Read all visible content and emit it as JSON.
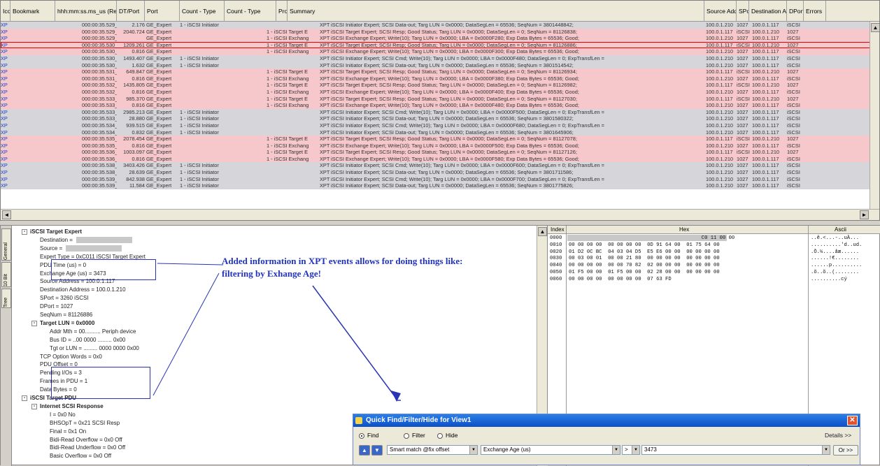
{
  "columns": [
    "Ico",
    "Bookmark",
    "hhh:mm:ss.ms_us (Rel)",
    "DT/Port",
    "Port",
    "Count - Type",
    "Count - Type",
    "Protoc",
    "Summary",
    "Source Addre",
    "SPort",
    "Destination Ad",
    "DPort",
    "Errors"
  ],
  "rows": [
    {
      "ico": "XP",
      "time": "000:00:35.529_477",
      "dt": "2.176",
      "port": "GE_Expert",
      "c1": "1 - iSCSI Initiator",
      "c2": "",
      "proto": "XPT",
      "summary": "iSCSI Initiator Expert; SCSI Data-out; Targ LUN = 0x0000; DataSegLen = 65536; SeqNum = 3801448842;",
      "src": "100.0.1.210",
      "sport": "1027",
      "dst": "100.0.1.117",
      "dport": "iSCSI",
      "c": "gray"
    },
    {
      "ico": "XP",
      "time": "000:00:35.529_549",
      "dt": "2040.724",
      "port": "GE_Expert",
      "c1": "",
      "c2": "1 - iSCSI Target E",
      "proto": "XPT",
      "summary": "iSCSI Target Expert; SCSI Resp; Good Status; Targ LUN = 0x0000; DataSegLen = 0; SeqNum = 81126838;",
      "src": "100.0.1.117",
      "sport": "iSCSI",
      "dst": "100.0.1.210",
      "dport": "1027",
      "c": "pink"
    },
    {
      "ico": "XP",
      "time": "000:00:35.529_549",
      "dt": "",
      "port": "GE_Expert",
      "c1": "",
      "c2": "1 - iSCSI Exchang",
      "proto": "XPT",
      "summary": "iSCSI Exchange Expert; Write(10); Targ LUN = 0x0000; LBA = 0x0000F280; Exp Data Bytes = 65536; Good;",
      "src": "100.0.1.210",
      "sport": "1027",
      "dst": "100.0.1.117",
      "dport": "iSCSI",
      "c": "pink"
    },
    {
      "ico": "XP",
      "time": "000:00:35.530_759",
      "dt": "1209.261",
      "port": "GE_Expert",
      "c1": "",
      "c2": "1 - iSCSI Target E",
      "proto": "XPT",
      "summary": "iSCSI Target Expert; SCSI Resp; Good Status; Targ LUN = 0x0000; DataSegLen = 0; SeqNum = 81126886;",
      "src": "100.0.1.117",
      "sport": "iSCSI",
      "dst": "100.0.1.210",
      "dport": "1027",
      "c": "pink sel"
    },
    {
      "ico": "XP",
      "time": "000:00:35.530_759",
      "dt": "0.816",
      "port": "GE_Expert",
      "c1": "",
      "c2": "1 - iSCSI Exchang",
      "proto": "XPT",
      "summary": "iSCSI Exchange Expert; Write(10); Targ LUN = 0x0000; LBA = 0x0000F300; Exp Data Bytes = 65536; Good;",
      "src": "100.0.1.210",
      "sport": "1027",
      "dst": "100.0.1.117",
      "dport": "iSCSI",
      "c": "pink"
    },
    {
      "ico": "XP",
      "time": "000:00:35.530_971",
      "dt": "1493.407",
      "port": "GE_Expert",
      "c1": "1 - iSCSI Initiator",
      "c2": "",
      "proto": "XPT",
      "summary": "iSCSI Initiator Expert; SCSI Cmd; Write(10); Targ LUN = 0x0000; LBA = 0x0000F480; DataSegLen = 0; ExpTransfLen =",
      "src": "100.0.1.210",
      "sport": "1027",
      "dst": "100.0.1.117",
      "dport": "iSCSI",
      "c": "gray"
    },
    {
      "ico": "XP",
      "time": "000:00:35.530_972",
      "dt": "1.632",
      "port": "GE_Expert",
      "c1": "1 - iSCSI Initiator",
      "c2": "",
      "proto": "XPT",
      "summary": "iSCSI Initiator Expert; SCSI Data-out; Targ LUN = 0x0000; DataSegLen = 65536; SeqNum = 3801514542;",
      "src": "100.0.1.210",
      "sport": "1027",
      "dst": "100.0.1.117",
      "dport": "iSCSI",
      "c": "gray"
    },
    {
      "ico": "XP",
      "time": "000:00:35.531_409",
      "dt": "649.847",
      "port": "GE_Expert",
      "c1": "",
      "c2": "1 - iSCSI Target E",
      "proto": "XPT",
      "summary": "iSCSI Target Expert; SCSI Resp; Good Status; Targ LUN = 0x0000; DataSegLen = 0; SeqNum = 81126934;",
      "src": "100.0.1.117",
      "sport": "iSCSI",
      "dst": "100.0.1.210",
      "dport": "1027",
      "c": "pink"
    },
    {
      "ico": "XP",
      "time": "000:00:35.531_410",
      "dt": "0.816",
      "port": "GE_Expert",
      "c1": "",
      "c2": "1 - iSCSI Exchang",
      "proto": "XPT",
      "summary": "iSCSI Exchange Expert; Write(10); Targ LUN = 0x0000; LBA = 0x0000F380; Exp Data Bytes = 65536; Good;",
      "src": "100.0.1.210",
      "sport": "1027",
      "dst": "100.0.1.117",
      "dport": "iSCSI",
      "c": "pink"
    },
    {
      "ico": "XP",
      "time": "000:00:35.532_846",
      "dt": "1435.805",
      "port": "GE_Expert",
      "c1": "",
      "c2": "1 - iSCSI Target E",
      "proto": "XPT",
      "summary": "iSCSI Target Expert; SCSI Resp; Good Status; Targ LUN = 0x0000; DataSegLen = 0; SeqNum = 81126982;",
      "src": "100.0.1.117",
      "sport": "iSCSI",
      "dst": "100.0.1.210",
      "dport": "1027",
      "c": "pink"
    },
    {
      "ico": "XP",
      "time": "000:00:35.532_847",
      "dt": "0.816",
      "port": "GE_Expert",
      "c1": "",
      "c2": "1 - iSCSI Exchang",
      "proto": "XPT",
      "summary": "iSCSI Exchange Expert; Write(10); Targ LUN = 0x0000; LBA = 0x0000F400; Exp Data Bytes = 65536; Good;",
      "src": "100.0.1.210",
      "sport": "1027",
      "dst": "100.0.1.117",
      "dport": "iSCSI",
      "c": "pink"
    },
    {
      "ico": "XP",
      "time": "000:00:35.533_832",
      "dt": "985.370",
      "port": "GE_Expert",
      "c1": "",
      "c2": "1 - iSCSI Target E",
      "proto": "XPT",
      "summary": "iSCSI Target Expert; SCSI Resp; Good Status; Targ LUN = 0x0000; DataSegLen = 0; SeqNum = 81127030;",
      "src": "100.0.1.117",
      "sport": "iSCSI",
      "dst": "100.0.1.210",
      "dport": "1027",
      "c": "pink"
    },
    {
      "ico": "XP",
      "time": "000:00:35.533_833",
      "dt": "0.816",
      "port": "GE_Expert",
      "c1": "",
      "c2": "1 - iSCSI Exchang",
      "proto": "XPT",
      "summary": "iSCSI Exchange Expert; Write(10); Targ LUN = 0x0000; LBA = 0x0000F480; Exp Data Bytes = 65536; Good;",
      "src": "100.0.1.210",
      "sport": "1027",
      "dst": "100.0.1.117",
      "dport": "iSCSI",
      "c": "pink"
    },
    {
      "ico": "XP",
      "time": "000:00:35.533_957",
      "dt": "2985.213",
      "port": "GE_Expert",
      "c1": "1 - iSCSI Initiator",
      "c2": "",
      "proto": "XPT",
      "summary": "iSCSI Initiator Expert; SCSI Cmd; Write(10); Targ LUN = 0x0000; LBA = 0x0000F500; DataSegLen = 0; ExpTransfLen =",
      "src": "100.0.1.210",
      "sport": "1027",
      "dst": "100.0.1.117",
      "dport": "iSCSI",
      "c": "gray"
    },
    {
      "ico": "XP",
      "time": "000:00:35.533_986",
      "dt": "28.880",
      "port": "GE_Expert",
      "c1": "1 - iSCSI Initiator",
      "c2": "",
      "proto": "XPT",
      "summary": "iSCSI Initiator Expert; SCSI Data-out; Targ LUN = 0x0000; DataSegLen = 65536; SeqNum = 3801580322;",
      "src": "100.0.1.210",
      "sport": "1027",
      "dst": "100.0.1.117",
      "dport": "iSCSI",
      "c": "gray"
    },
    {
      "ico": "XP",
      "time": "000:00:35.534_926",
      "dt": "939.515",
      "port": "GE_Expert",
      "c1": "1 - iSCSI Initiator",
      "c2": "",
      "proto": "XPT",
      "summary": "iSCSI Initiator Expert; SCSI Cmd; Write(10); Targ LUN = 0x0000; LBA = 0x0000F680; DataSegLen = 0; ExpTransfLen =",
      "src": "100.0.1.210",
      "sport": "1027",
      "dst": "100.0.1.117",
      "dport": "iSCSI",
      "c": "gray"
    },
    {
      "ico": "XP",
      "time": "000:00:35.534_927",
      "dt": "0.832",
      "port": "GE_Expert",
      "c1": "1 - iSCSI Initiator",
      "c2": "",
      "proto": "XPT",
      "summary": "iSCSI Initiator Expert; SCSI Data-out; Targ LUN = 0x0000; DataSegLen = 65536; SeqNum = 3801645906;",
      "src": "100.0.1.210",
      "sport": "1027",
      "dst": "100.0.1.117",
      "dport": "iSCSI",
      "c": "gray"
    },
    {
      "ico": "XP",
      "time": "000:00:35.535_911",
      "dt": "2078.454",
      "port": "GE_Expert",
      "c1": "",
      "c2": "1 - iSCSI Target E",
      "proto": "XPT",
      "summary": "iSCSI Target Expert; SCSI Resp; Good Status; Targ LUN = 0x0000; DataSegLen = 0; SeqNum = 81127078;",
      "src": "100.0.1.117",
      "sport": "iSCSI",
      "dst": "100.0.1.210",
      "dport": "1027",
      "c": "pink"
    },
    {
      "ico": "XP",
      "time": "000:00:35.535_912",
      "dt": "0.816",
      "port": "GE_Expert",
      "c1": "",
      "c2": "1 - iSCSI Exchang",
      "proto": "XPT",
      "summary": "iSCSI Exchange Expert; Write(10); Targ LUN = 0x0000; LBA = 0x0000F500; Exp Data Bytes = 65536; Good;",
      "src": "100.0.1.210",
      "sport": "1027",
      "dst": "100.0.1.117",
      "dport": "iSCSI",
      "c": "pink"
    },
    {
      "ico": "XP",
      "time": "000:00:35.536_915",
      "dt": "1003.097",
      "port": "GE_Expert",
      "c1": "",
      "c2": "1 - iSCSI Target E",
      "proto": "XPT",
      "summary": "iSCSI Target Expert; SCSI Resp; Good Status; Targ LUN = 0x0000; DataSegLen = 0; SeqNum = 81127126;",
      "src": "100.0.1.117",
      "sport": "iSCSI",
      "dst": "100.0.1.210",
      "dport": "1027",
      "c": "pink"
    },
    {
      "ico": "XP",
      "time": "000:00:35.536_916",
      "dt": "0.816",
      "port": "GE_Expert",
      "c1": "",
      "c2": "1 - iSCSI Exchang",
      "proto": "XPT",
      "summary": "iSCSI Exchange Expert; Write(10); Targ LUN = 0x0000; LBA = 0x0000F580; Exp Data Bytes = 65536; Good;",
      "src": "100.0.1.210",
      "sport": "1027",
      "dst": "100.0.1.117",
      "dport": "iSCSI",
      "c": "pink"
    },
    {
      "ico": "XP",
      "time": "000:00:35.538_330",
      "dt": "3403.426",
      "port": "GE_Expert",
      "c1": "1 - iSCSI Initiator",
      "c2": "",
      "proto": "XPT",
      "summary": "iSCSI Initiator Expert; SCSI Cmd; Write(10); Targ LUN = 0x0000; LBA = 0x0000F600; DataSegLen = 0; ExpTransfLen =",
      "src": "100.0.1.210",
      "sport": "1027",
      "dst": "100.0.1.117",
      "dport": "iSCSI",
      "c": "gray"
    },
    {
      "ico": "XP",
      "time": "000:00:35.538_359",
      "dt": "28.639",
      "port": "GE_Expert",
      "c1": "1 - iSCSI Initiator",
      "c2": "",
      "proto": "XPT",
      "summary": "iSCSI Initiator Expert; SCSI Data-out; Targ LUN = 0x0000; DataSegLen = 65536; SeqNum = 3801711586;",
      "src": "100.0.1.210",
      "sport": "1027",
      "dst": "100.0.1.117",
      "dport": "iSCSI",
      "c": "gray"
    },
    {
      "ico": "XP",
      "time": "000:00:35.539_202",
      "dt": "842.938",
      "port": "GE_Expert",
      "c1": "1 - iSCSI Initiator",
      "c2": "",
      "proto": "XPT",
      "summary": "iSCSI Initiator Expert; SCSI Cmd; Write(10); Targ LUN = 0x0000; LBA = 0x0000F700; DataSegLen = 0; ExpTransfLen =",
      "src": "100.0.1.210",
      "sport": "1027",
      "dst": "100.0.1.117",
      "dport": "iSCSI",
      "c": "gray"
    },
    {
      "ico": "XP",
      "time": "000:00:35.539_213",
      "dt": "11.584",
      "port": "GE_Expert",
      "c1": "1 - iSCSI Initiator",
      "c2": "",
      "proto": "XPT",
      "summary": "iSCSI Initiator Expert; SCSI Data-out; Targ LUN = 0x0000; DataSegLen = 65536; SeqNum = 3801775826;",
      "src": "100.0.1.210",
      "sport": "1027",
      "dst": "100.0.1.117",
      "dport": "iSCSI",
      "c": "gray"
    }
  ],
  "vtabs": [
    "General",
    "10 Bit",
    "Tree"
  ],
  "tree": [
    {
      "t": "iSCSI Target Expert",
      "pm": "-",
      "b": true
    },
    {
      "t": "Destination = ",
      "g": true
    },
    {
      "t": "Source = ",
      "g": true
    },
    {
      "t": "Expert Type = 0xC011  iSCSI Target Expert"
    },
    {
      "t": "PDU Time (us) = 0"
    },
    {
      "t": "Exchange Age (us) = 3473"
    },
    {
      "t": "Source Address = 100.0.1.117"
    },
    {
      "t": "Destination Address = 100.0.1.210"
    },
    {
      "t": "SPort = 3260  iSCSI"
    },
    {
      "t": "DPort = 1027"
    },
    {
      "t": "SeqNum = 81126886"
    },
    {
      "t": "Target LUN = 0x0000",
      "pm": "-",
      "b": true
    },
    {
      "t": "Addr Mth = 00.......... Periph device"
    },
    {
      "t": "Bus ID = ..00 0000 ......... 0x00"
    },
    {
      "t": "Tgt or LUN = ......... 0000 0000 0x00"
    },
    {
      "t": "TCP Option Words = 0x0"
    },
    {
      "t": "PDU Offset = 0"
    },
    {
      "t": "Pending I/Os = 3"
    },
    {
      "t": "Frames in PDU = 1"
    },
    {
      "t": "Data Bytes = 0"
    },
    {
      "t": "iSCSI Target PDU",
      "pm": "-",
      "b": true
    },
    {
      "t": "Internet SCSI Response",
      "pm": "-",
      "b": true
    },
    {
      "t": "I = 0x0  No"
    },
    {
      "t": "BHSOpT = 0x21  SCSI Resp"
    },
    {
      "t": "Final = 0x1  On"
    },
    {
      "t": "Bidi-Read Overflow = 0x0  Off"
    },
    {
      "t": "Bidi-Read Underflow = 0x0  Off"
    },
    {
      "t": "Basic Overflow = 0x0  Off"
    }
  ],
  "annotation": "Added information in XPT events allows for doing things like: filtering by Exhange Age!",
  "hex": {
    "headers": {
      "index": "Index",
      "hex": "Hex",
      "ascii": "Ascii"
    },
    "rows": [
      {
        "i": "0000",
        "h": "                                            C0 11 00 00",
        "a": "..ê.<...-..uÀ..."
      },
      {
        "i": "0010",
        "h": "00 00 00 00  00 00 00 00  0D 91 64 00  01 75 64 00",
        "a": "..........'d..ud."
      },
      {
        "i": "0020",
        "h": "01 D2 0C BC  04 03 04 D5  E5 E6 00 00  00 00 00 00",
        "a": ".Ò.¼....åæ......"
      },
      {
        "i": "0030",
        "h": "00 03 00 01  00 00 21 80  00 00 00 00  00 00 00 00",
        "a": "......!€........"
      },
      {
        "i": "0040",
        "h": "00 00 00 00  00 00 70 82  02 00 00 00  00 00 00 00",
        "a": "......p.........."
      },
      {
        "i": "0050",
        "h": "01 F5 00 00  01 F5 00 00  02 28 00 00  00 00 00 00",
        "a": ".õ..õ..(........"
      },
      {
        "i": "0060",
        "h": "00 00 00 00  00 00 00 00  07 63 FD",
        "a": "..........cý"
      }
    ]
  },
  "qf": {
    "title": "Quick Find/Filter/Hide for View1",
    "radios": [
      "Find",
      "Filter",
      "Hide"
    ],
    "details": "Details >>",
    "match": "Smart match @fix offset",
    "field": "Exchange Age (us)",
    "op": ">",
    "value": "3473",
    "or": "Or >>"
  },
  "colors": {
    "pink": "#f6c8cc",
    "gray": "#d6d6da",
    "annotation": "#2233bb",
    "titlebar": "#0d4fc6"
  }
}
